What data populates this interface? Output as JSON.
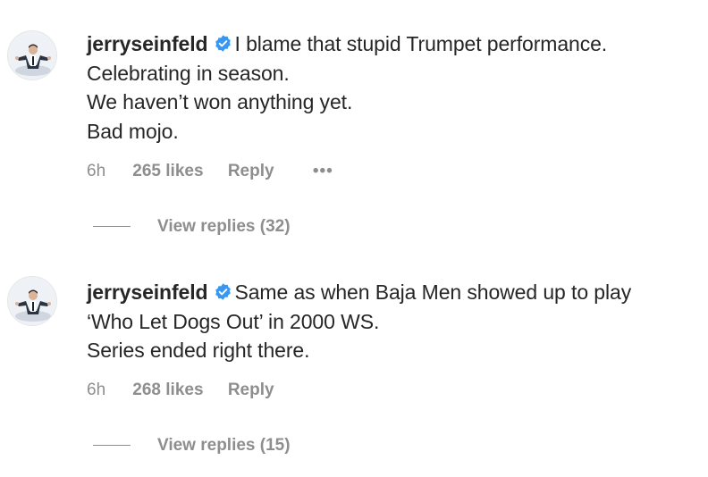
{
  "comments": [
    {
      "username": "jerryseinfeld",
      "lines": [
        "I blame that stupid Trumpet performance.",
        "Celebrating in season.",
        "We haven’t won anything yet.",
        "Bad mojo."
      ],
      "time": "6h",
      "likes": "265 likes",
      "reply": "Reply",
      "more": "•••",
      "view_replies": "View replies (32)"
    },
    {
      "username": "jerryseinfeld",
      "lines": [
        "Same as when Baja Men showed up to play",
        "‘Who Let Dogs Out’ in 2000 WS.",
        "Series ended right there."
      ],
      "time": "6h",
      "likes": "268 likes",
      "reply": "Reply",
      "view_replies": "View replies (15)"
    }
  ],
  "colors": {
    "text": "#262626",
    "secondary": "#8e8e8e",
    "verified": "#3897f0"
  },
  "icons": {
    "verified": "verified-badge-icon",
    "avatar": "profile-avatar"
  }
}
